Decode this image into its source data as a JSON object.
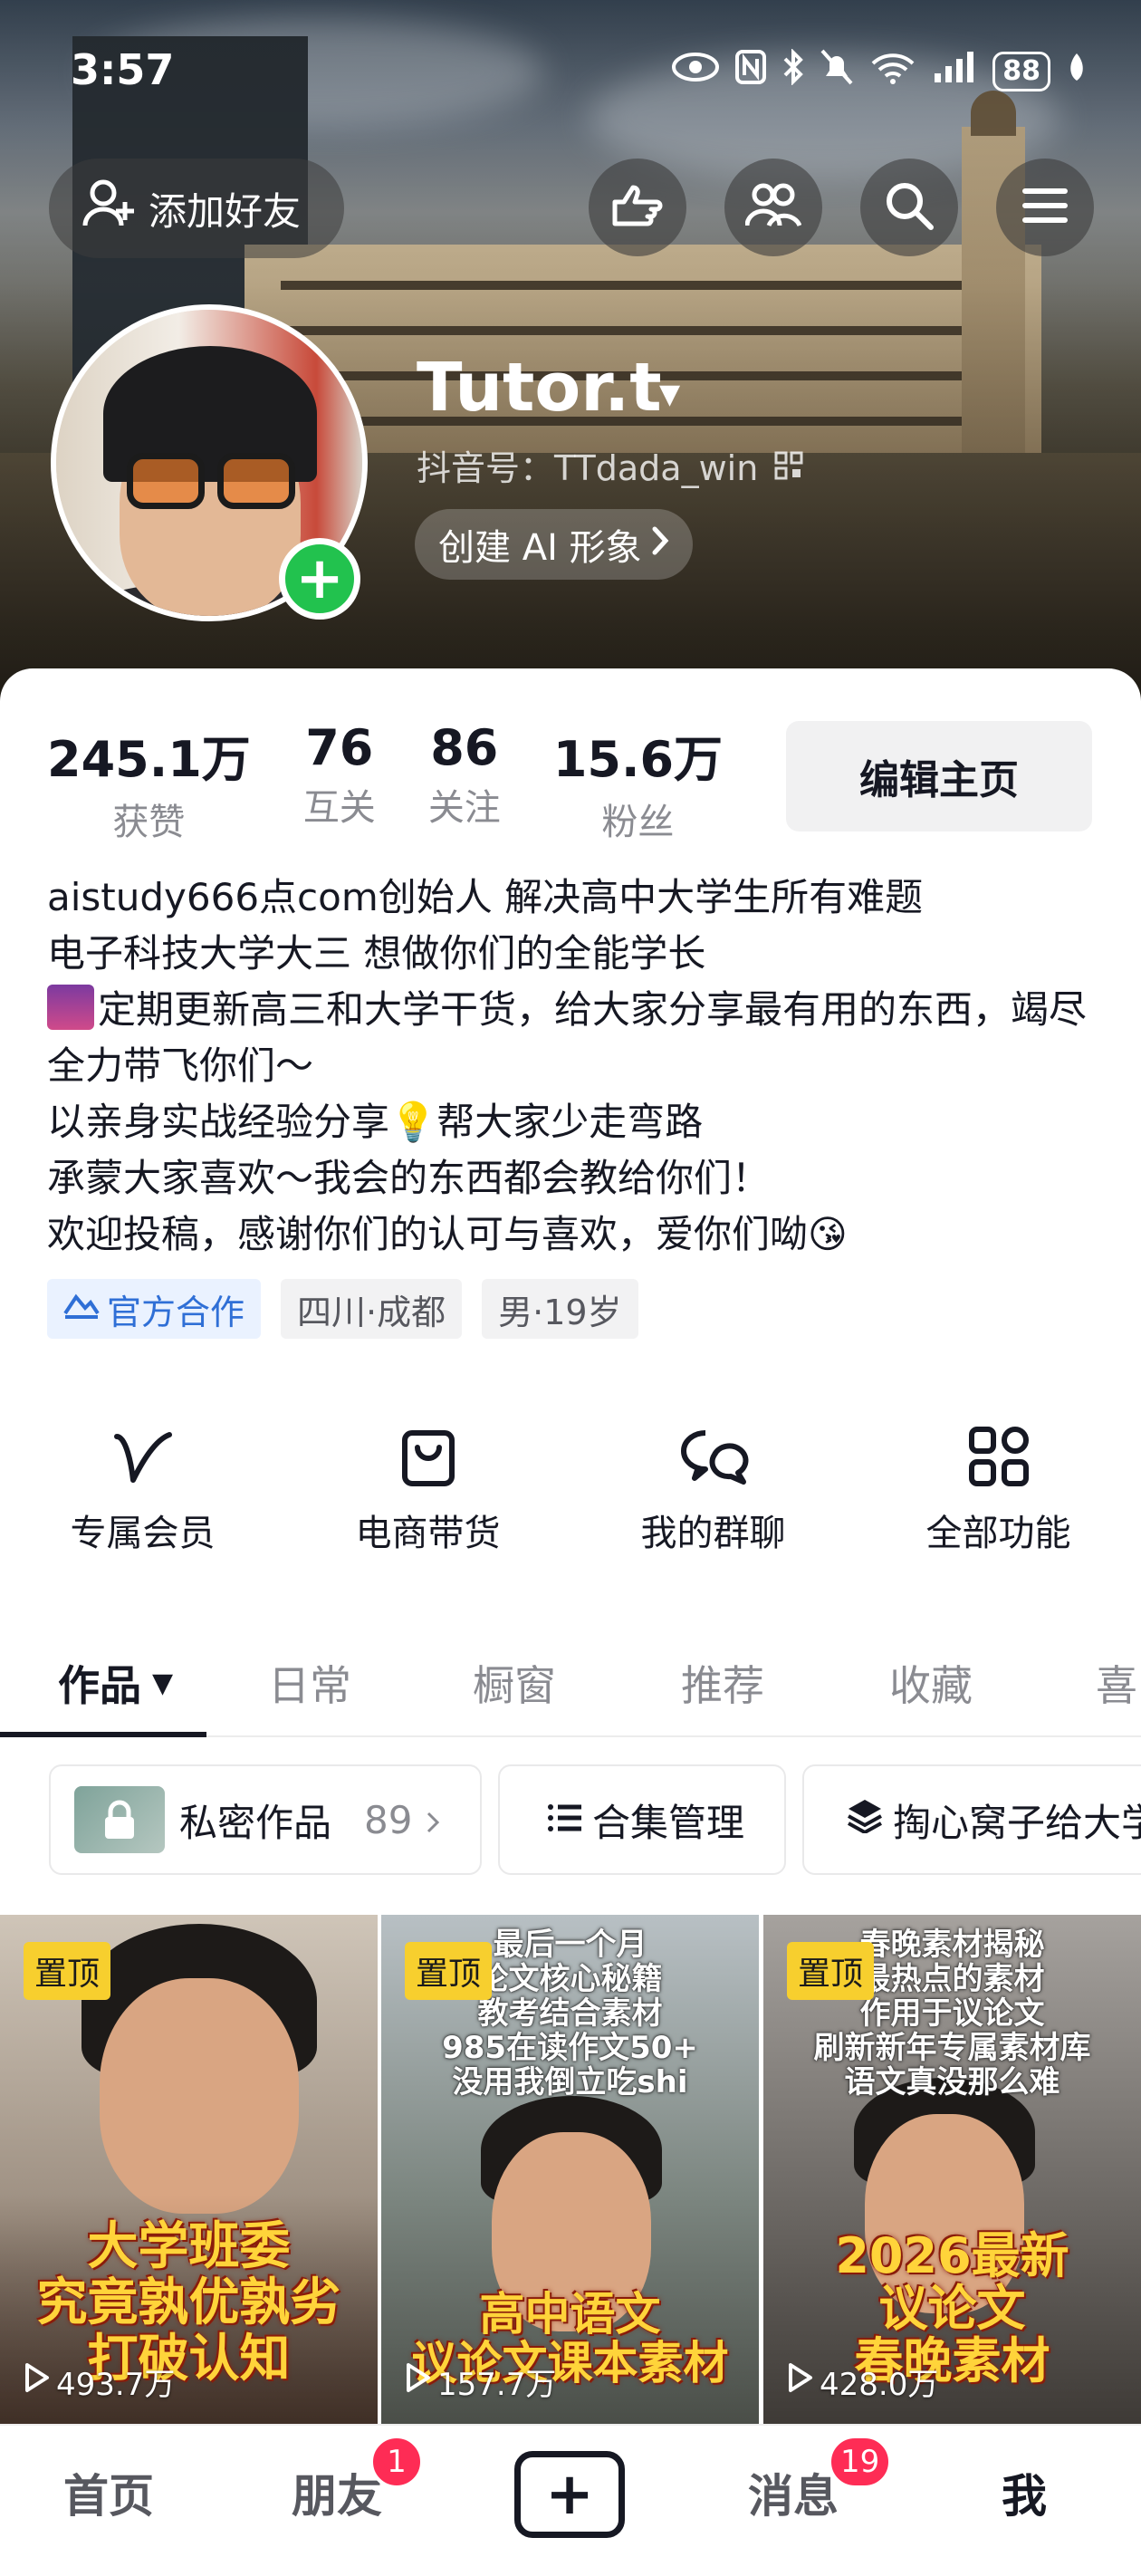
{
  "status_bar": {
    "time": "3:57",
    "battery": "88"
  },
  "header": {
    "add_friend_label": "添加好友",
    "nickname": "Tutor.t",
    "douyin_id": "抖音号：TTdada_win",
    "ai_button_label": "创建 AI 形象"
  },
  "stats": [
    {
      "value": "245.1万",
      "label": "获赞"
    },
    {
      "value": "76",
      "label": "互关"
    },
    {
      "value": "86",
      "label": "关注"
    },
    {
      "value": "15.6万",
      "label": "粉丝"
    }
  ],
  "edit_profile_label": "编辑主页",
  "bio": [
    "aistudy666点com创始人 解决高中大学生所有难题",
    "电子科技大学大三 想做你们的全能学长",
    "定期更新高三和大学干货，给大家分享最有用的东西，竭尽全力带飞你们～",
    "以亲身实战经验分享💡帮大家少走弯路",
    "承蒙大家喜欢～我会的东西都会教给你们！",
    "欢迎投稿，感谢你们的认可与喜欢，爱你们呦😘"
  ],
  "tags": [
    "官方合作",
    "四川·成都",
    "男·19岁"
  ],
  "features": [
    {
      "label": "专属会员",
      "icon": "vip-v-icon"
    },
    {
      "label": "电商带货",
      "icon": "shopping-bag-icon"
    },
    {
      "label": "我的群聊",
      "icon": "group-chat-icon"
    },
    {
      "label": "全部功能",
      "icon": "all-functions-icon"
    }
  ],
  "tabs": [
    "作品",
    "日常",
    "橱窗",
    "推荐",
    "收藏",
    "喜"
  ],
  "chips": {
    "private_label": "私密作品",
    "private_count": "89",
    "collection_label": "合集管理",
    "third_label": "掏心窝子给大学"
  },
  "videos": [
    {
      "pinned": "置顶",
      "plays": "493.7万",
      "caption_top": "",
      "caption_bottom": "大学班委\n究竟孰优孰劣\n打破认知"
    },
    {
      "pinned": "置顶",
      "plays": "157.7万",
      "caption_top": "最后一个月\n论文核心秘籍\n教考结合素材\n985在读作文50+\n没用我倒立吃shi",
      "caption_bottom": "高中语文\n议论文课本素材"
    },
    {
      "pinned": "置顶",
      "plays": "428.0万",
      "caption_top": "春晚素材揭秘\n最热点的素材\n作用于议论文\n刷新新年专属素材库\n语文真没那么难",
      "caption_bottom": "2026最新\n议论文\n春晚素材"
    }
  ],
  "bottom_nav": {
    "home": "首页",
    "friends": "朋友",
    "friends_badge": "1",
    "create": "+",
    "messages": "消息",
    "messages_badge": "19",
    "me": "我"
  }
}
